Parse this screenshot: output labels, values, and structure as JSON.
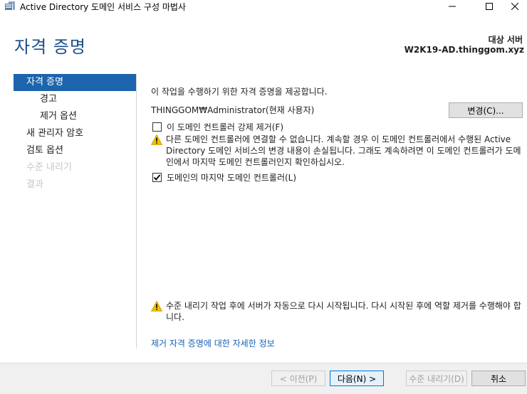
{
  "window": {
    "title": "Active Directory 도메인 서비스 구성 마법사"
  },
  "header": {
    "page_title": "자격 증명",
    "target_label": "대상 서버",
    "target_name": "W2K19-AD.thinggom.xyz"
  },
  "nav": {
    "items": [
      {
        "label": "자격 증명"
      },
      {
        "label": "경고"
      },
      {
        "label": "제거 옵션"
      },
      {
        "label": "새 관리자 암호"
      },
      {
        "label": "검토 옵션"
      },
      {
        "label": "수준 내리기"
      },
      {
        "label": "결과"
      }
    ]
  },
  "main": {
    "intro": "이 작업을 수행하기 위한 자격 증명을 제공합니다.",
    "credential": "THINGGOM₩Administrator(현재 사용자)",
    "change_button": "변경(C)...",
    "force_remove_label": "이 도메인 컨트롤러 강제 제거(F)",
    "force_remove_checked": false,
    "warning_connect": "다른 도메인 컨트롤러에 연결할 수 없습니다. 계속할 경우 이 도메인 컨트롤러에서 수행된 Active Directory 도메인 서비스의 변경 내용이 손실됩니다. 그래도 계속하려면 이 도메인 컨트롤러가 도메인에서 마지막 도메인 컨트롤러인지 확인하십시오.",
    "last_dc_label": "도메인의 마지막 도메인 컨트롤러(L)",
    "last_dc_checked": true,
    "warning_restart": "수준 내리기 작업 후에 서버가 자동으로 다시 시작됩니다. 다시 시작된 후에 역할 제거를 수행해야 합니다.",
    "more_info_link": "제거 자격 증명에 대한 자세한 정보"
  },
  "footer": {
    "prev_button": "< 이전(P)",
    "next_button": "다음(N) >",
    "demote_button": "수준 내리기(D)",
    "cancel_button": "취소"
  },
  "colors": {
    "accent": "#1c64ad",
    "title_blue": "#1a4f8a",
    "link": "#1660b8",
    "warning": "#f2c100"
  }
}
